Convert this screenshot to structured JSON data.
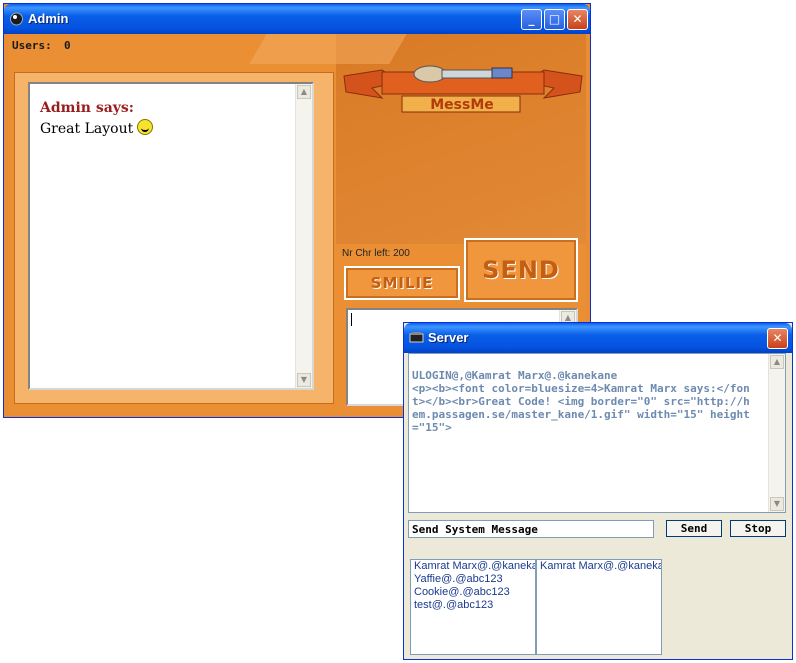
{
  "admin_window": {
    "title": "Admin",
    "users_label": "Users:",
    "users_count": "0",
    "chat": {
      "sender": "Admin says:",
      "message": "Great Layout"
    },
    "logo_text": "MessMe",
    "chars_left": "Nr Chr left: 200",
    "smilie_button": "SMILIE",
    "send_button": "SEND"
  },
  "server_window": {
    "title": "Server",
    "log": "ULOGIN@,@Kamrat Marx@.@kanekane\n<p><b><font color=bluesize=4>Kamrat Marx says:</font></b><br>Great Code! <img border=\"0\" src=\"http://hem.passagen.se/master_kane/1.gif\" width=\"15\" height=\"15\">",
    "system_message_value": "Send System Message",
    "send_button": "Send",
    "stop_button": "Stop",
    "list_left": [
      "Kamrat Marx@.@kanekane",
      "Yaffie@.@abc123",
      "Cookie@.@abc123",
      "test@.@abc123"
    ],
    "list_right": [
      "Kamrat Marx@.@kanekane"
    ]
  },
  "colors": {
    "xp_blue": "#0a5ef0",
    "admin_orange": "#ea8f33",
    "server_bg": "#ece9d8",
    "log_text": "#6d8ab0"
  }
}
